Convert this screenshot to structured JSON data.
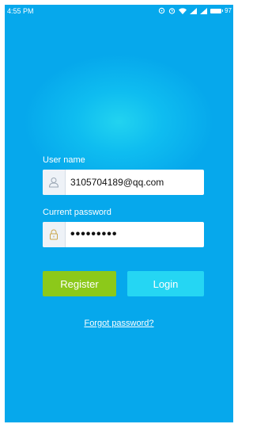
{
  "status_bar": {
    "time": "4:55 PM",
    "battery_text": "97",
    "icons": [
      "sync-icon",
      "alarm-icon",
      "wifi-icon",
      "signal-icon",
      "signal-icon",
      "battery-icon"
    ]
  },
  "form": {
    "username_label": "User name",
    "username_value": "3105704189@qq.com",
    "password_label": "Current password",
    "password_value": "•••••••••"
  },
  "buttons": {
    "register_label": "Register",
    "login_label": "Login"
  },
  "links": {
    "forgot_password": "Forgot password?"
  },
  "colors": {
    "background": "#06a8ec",
    "glow": "#22d3f0",
    "register_button": "#8cc91a",
    "login_button": "#25d6f3"
  }
}
